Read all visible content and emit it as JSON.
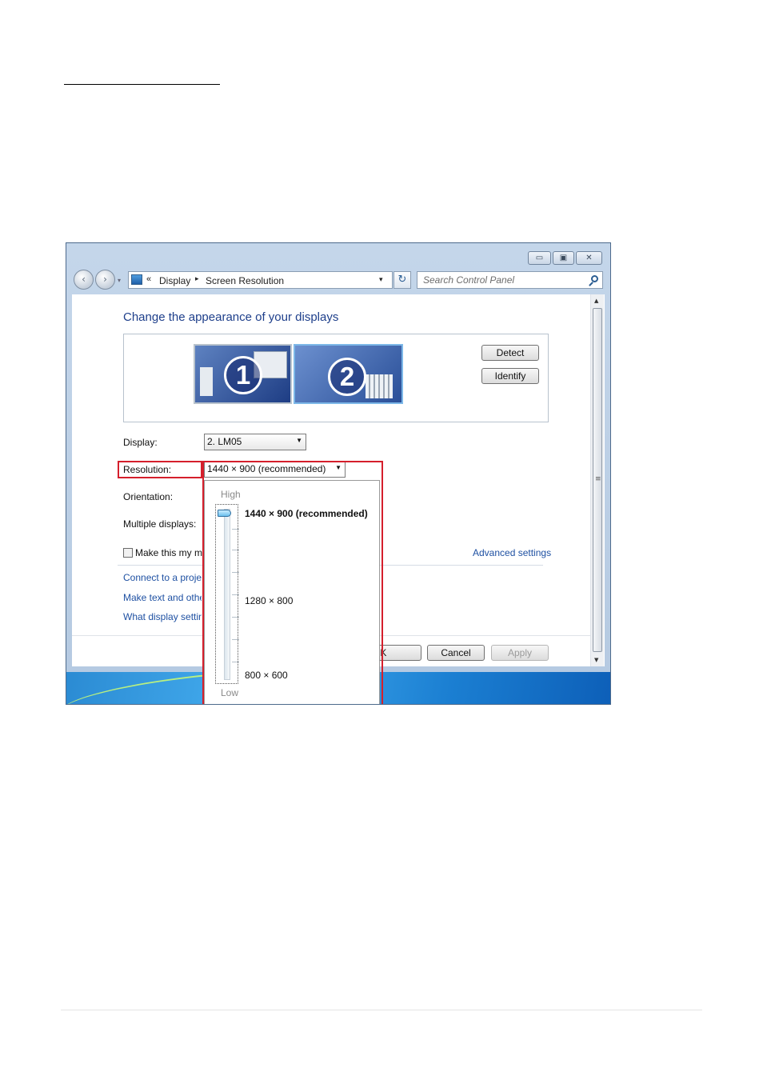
{
  "window": {
    "controls": {
      "minimize": "▭",
      "maximize": "▣",
      "close": "✕"
    },
    "nav": {
      "back": "‹",
      "forward": "›",
      "history_dropdown": "▾"
    },
    "address": {
      "chevron": "«",
      "crumbs": [
        "Display",
        "Screen Resolution"
      ],
      "separator": "▸",
      "dropdown": "▾"
    },
    "refresh_glyph": "↻",
    "search": {
      "placeholder": "Search Control Panel"
    }
  },
  "main": {
    "title": "Change the appearance of your displays",
    "monitors": [
      {
        "number": "1",
        "selected": false
      },
      {
        "number": "2",
        "selected": true
      }
    ],
    "buttons": {
      "detect": "Detect",
      "identify": "Identify"
    },
    "fields": {
      "display_label": "Display:",
      "display_value": "2. LM05",
      "resolution_label": "Resolution:",
      "resolution_value": "1440 × 900 (recommended)",
      "orientation_label": "Orientation:",
      "multiple_label": "Multiple displays:"
    },
    "checkbox_label": "Make this my m",
    "advanced_link": "Advanced settings",
    "links": [
      "Connect to a projec",
      "Make text and othe",
      "What display settin"
    ],
    "dialog_buttons": {
      "ok": "OK",
      "cancel": "Cancel",
      "apply": "Apply"
    }
  },
  "resolution_dropdown": {
    "high_label": "High",
    "low_label": "Low",
    "options": [
      "1440 × 900 (recommended)",
      "1280 × 800",
      "800 × 600"
    ],
    "selected_index": 0,
    "slider_level": 1.0
  },
  "scrollbar": {
    "up": "▲",
    "down": "▼",
    "grip": "≡"
  },
  "colors": {
    "highlight_box": "#d51f2c",
    "title_blue": "#1e3f8b",
    "link_blue": "#1e50a2",
    "window_frame": "#c4d6ea"
  },
  "icons": [
    "search-icon",
    "refresh-icon",
    "control-panel-icon",
    "chevron-down-icon",
    "back-arrow-icon",
    "forward-arrow-icon"
  ]
}
